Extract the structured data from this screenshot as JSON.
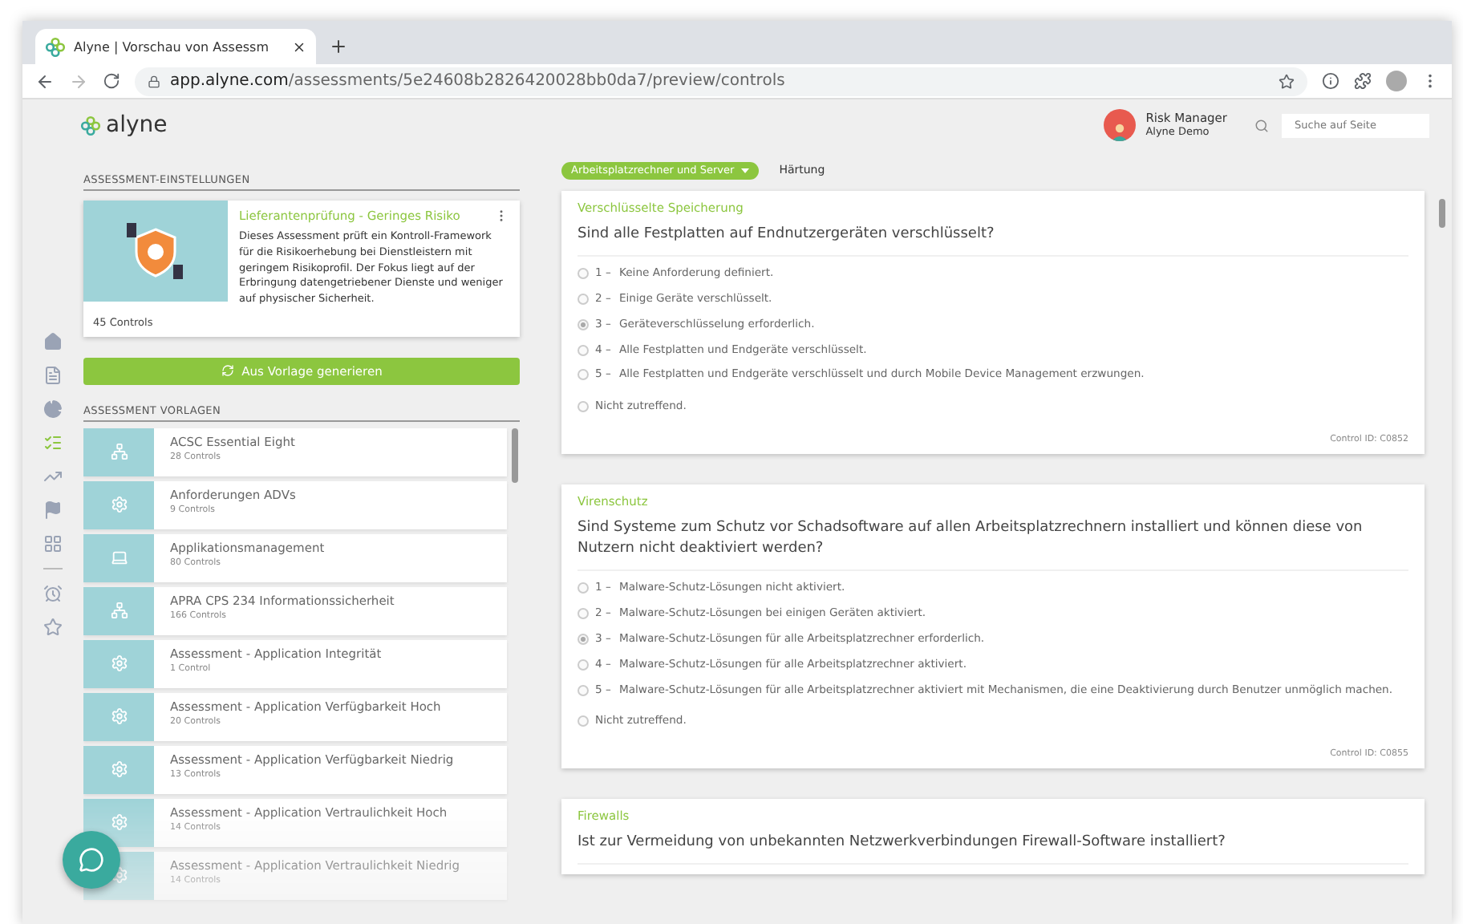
{
  "browser": {
    "tab_title": "Alyne | Vorschau von Assessm",
    "url_host": "app.alyne.com",
    "url_path": "/assessments/5e24608b2826420028bb0da7/preview/controls"
  },
  "header": {
    "logo": "alyne",
    "user_role": "Risk Manager",
    "user_org": "Alyne Demo",
    "search": {
      "placeholder": "Suche auf Seite"
    }
  },
  "nav": [
    {
      "selected": false
    },
    {
      "selected": false
    },
    {
      "selected": false
    },
    {
      "selected": true
    },
    {
      "selected": false
    },
    {
      "selected": false
    },
    {
      "selected": false
    },
    {
      "selected": false
    },
    {
      "selected": false
    }
  ],
  "settings": {
    "heading": "ASSESSMENT-EINSTELLUNGEN",
    "card": {
      "title": "Lieferantenprüfung - Geringes Risiko",
      "description": "Dieses Assessment prüft ein Kontroll-Framework für die Risikoerhebung bei Dienstleistern mit geringem Risikoprofil. Der Fokus liegt auf der Erbringung datengetriebener Dienste und weniger auf physischer Sicherheit.",
      "count": "45 Controls"
    },
    "button": "Aus Vorlage generieren"
  },
  "templates": {
    "heading": "ASSESSMENT VORLAGEN",
    "items": [
      {
        "title": "ACSC Essential Eight",
        "count": "28 Controls",
        "kind": "network"
      },
      {
        "title": "Anforderungen ADVs",
        "count": "9 Controls",
        "kind": "gear"
      },
      {
        "title": "Applikationsmanagement",
        "count": "80 Controls",
        "kind": "laptop"
      },
      {
        "title": "APRA CPS 234 Informationssicherheit",
        "count": "166 Controls",
        "kind": "network"
      },
      {
        "title": "Assessment - Application Integrität",
        "count": "1 Control",
        "kind": "gear"
      },
      {
        "title": "Assessment - Application Verfügbarkeit Hoch",
        "count": "20 Controls",
        "kind": "gear"
      },
      {
        "title": "Assessment - Application Verfügbarkeit Niedrig",
        "count": "13 Controls",
        "kind": "gear"
      },
      {
        "title": "Assessment - Application Vertraulichkeit Hoch",
        "count": "14 Controls",
        "kind": "gear"
      },
      {
        "title": "Assessment - Application Vertraulichkeit Niedrig",
        "count": "14 Controls",
        "kind": "gear"
      }
    ]
  },
  "filter": {
    "chip": "Arbeitsplatzrechner und Server",
    "label": "Härtung"
  },
  "controls": [
    {
      "title": "Verschlüsselte Speicherung",
      "question": "Sind alle Festplatten auf Endnutzergeräten verschlüsselt?",
      "options": [
        {
          "number": "1 –",
          "text": "Keine Anforderung definiert.",
          "selected": false
        },
        {
          "number": "2 –",
          "text": "Einige Geräte verschlüsselt.",
          "selected": false
        },
        {
          "number": "3 –",
          "text": "Geräteverschlüsselung erforderlich.",
          "selected": true
        },
        {
          "number": "4 –",
          "text": "Alle Festplatten und Endgeräte verschlüsselt.",
          "selected": false
        },
        {
          "number": "5 –",
          "text": "Alle Festplatten und Endgeräte verschlüsselt und durch Mobile Device Management erzwungen.",
          "selected": false
        }
      ],
      "not_applicable": {
        "text": "Nicht zutreffend.",
        "selected": false
      },
      "control_id": "Control ID: C0852"
    },
    {
      "title": "Virenschutz",
      "question": "Sind Systeme zum Schutz vor Schadsoftware auf allen Arbeitsplatzrechnern installiert und können diese von Nutzern nicht deaktiviert werden?",
      "options": [
        {
          "number": "1 –",
          "text": "Malware-Schutz-Lösungen nicht aktiviert.",
          "selected": false
        },
        {
          "number": "2 –",
          "text": "Malware-Schutz-Lösungen bei einigen Geräten aktiviert.",
          "selected": false
        },
        {
          "number": "3 –",
          "text": "Malware-Schutz-Lösungen für alle Arbeitsplatzrechner erforderlich.",
          "selected": true
        },
        {
          "number": "4 –",
          "text": "Malware-Schutz-Lösungen für alle Arbeitsplatzrechner aktiviert.",
          "selected": false
        },
        {
          "number": "5 –",
          "text": "Malware-Schutz-Lösungen für alle Arbeitsplatzrechner aktiviert mit Mechanismen, die eine Deaktivierung durch Benutzer unmöglich machen.",
          "selected": false
        }
      ],
      "not_applicable": {
        "text": "Nicht zutreffend.",
        "selected": false
      },
      "control_id": "Control ID: C0855"
    },
    {
      "title": "Firewalls",
      "question": "Ist zur Vermeidung von unbekannten Netzwerkverbindungen Firewall-Software installiert?"
    }
  ]
}
